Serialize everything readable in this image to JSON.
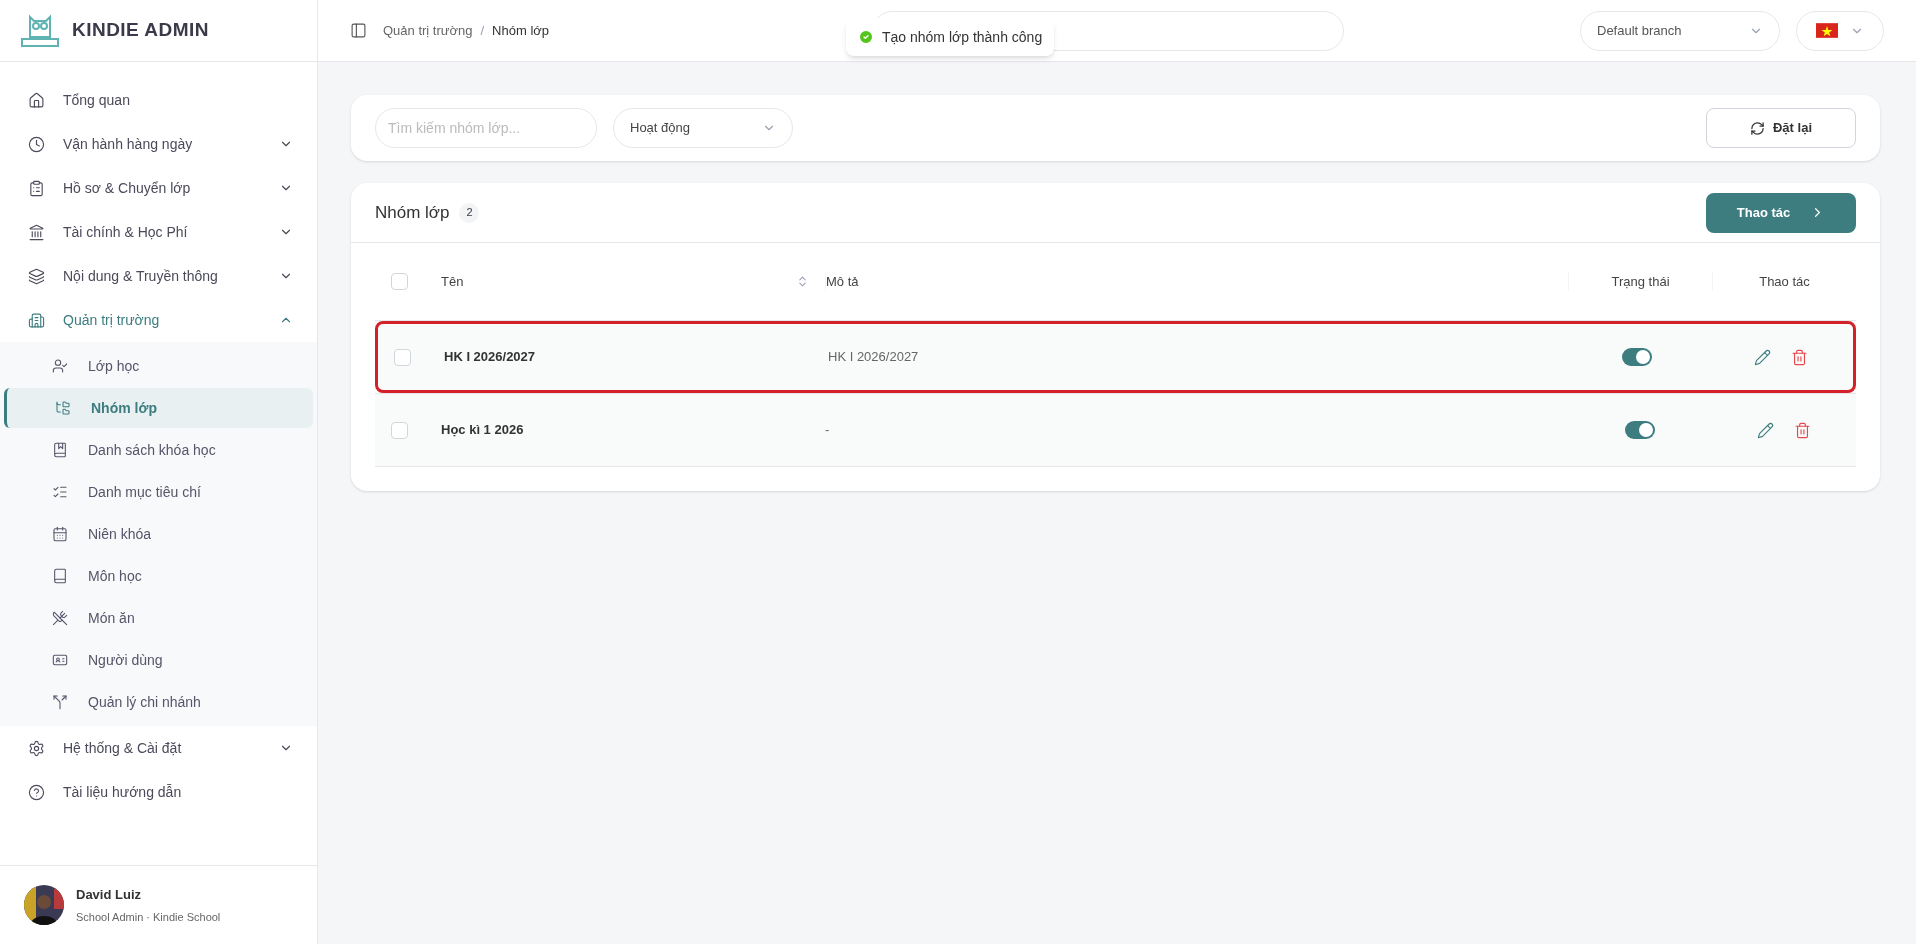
{
  "brand": {
    "title": "KINDIE ADMIN"
  },
  "sidebar": {
    "items": [
      {
        "label": "Tổng quan",
        "selected": false
      },
      {
        "label": "Vận hành hàng ngày",
        "expanded": false,
        "selected": false
      },
      {
        "label": "Hồ sơ & Chuyển lớp",
        "expanded": false,
        "selected": false
      },
      {
        "label": "Tài chính & Học Phí",
        "expanded": false,
        "selected": false
      },
      {
        "label": "Nội dung & Truyền thông",
        "expanded": false,
        "selected": false
      },
      {
        "label": "Quản trị trường",
        "expanded": true,
        "selected": true,
        "children": [
          {
            "label": "Lớp học",
            "selected": false
          },
          {
            "label": "Nhóm lớp",
            "selected": true
          },
          {
            "label": "Danh sách khóa học",
            "selected": false
          },
          {
            "label": "Danh mục tiêu chí",
            "selected": false
          },
          {
            "label": "Niên khóa",
            "selected": false
          },
          {
            "label": "Môn học",
            "selected": false
          },
          {
            "label": "Món ăn",
            "selected": false
          },
          {
            "label": "Người dùng",
            "selected": false
          },
          {
            "label": "Quản lý chi nhánh",
            "selected": false
          }
        ]
      },
      {
        "label": "Hệ thống & Cài đặt",
        "expanded": false,
        "selected": false
      },
      {
        "label": "Tài liệu hướng dẫn",
        "selected": false
      }
    ]
  },
  "user": {
    "name": "David Luiz",
    "role": "School Admin · Kindie School"
  },
  "header": {
    "breadcrumb": [
      "Quản trị trường",
      "Nhóm lớp"
    ],
    "breadcrumb_separator": "/",
    "toast": {
      "text": "Tạo nhóm lớp thành công"
    },
    "branch_select": {
      "value": "Default branch"
    }
  },
  "filters": {
    "search": {
      "placeholder": "Tìm kiếm nhóm lớp..."
    },
    "status_select": {
      "value": "Hoạt động"
    },
    "reset_button": "Đặt lại"
  },
  "table": {
    "title": "Nhóm lớp",
    "count": "2",
    "all_checked": false,
    "action_button": "Thao tác",
    "columns": [
      "Tên",
      "Mô tả",
      "Trạng thái",
      "Thao tác"
    ],
    "rows": [
      {
        "name": "HK I 2026/2027",
        "description": "HK I 2026/2027",
        "checked": false,
        "active": true,
        "highlighted": true
      },
      {
        "name": "Học kì 1 2026",
        "description": "-",
        "checked": false,
        "active": true,
        "highlighted": false
      }
    ]
  }
}
